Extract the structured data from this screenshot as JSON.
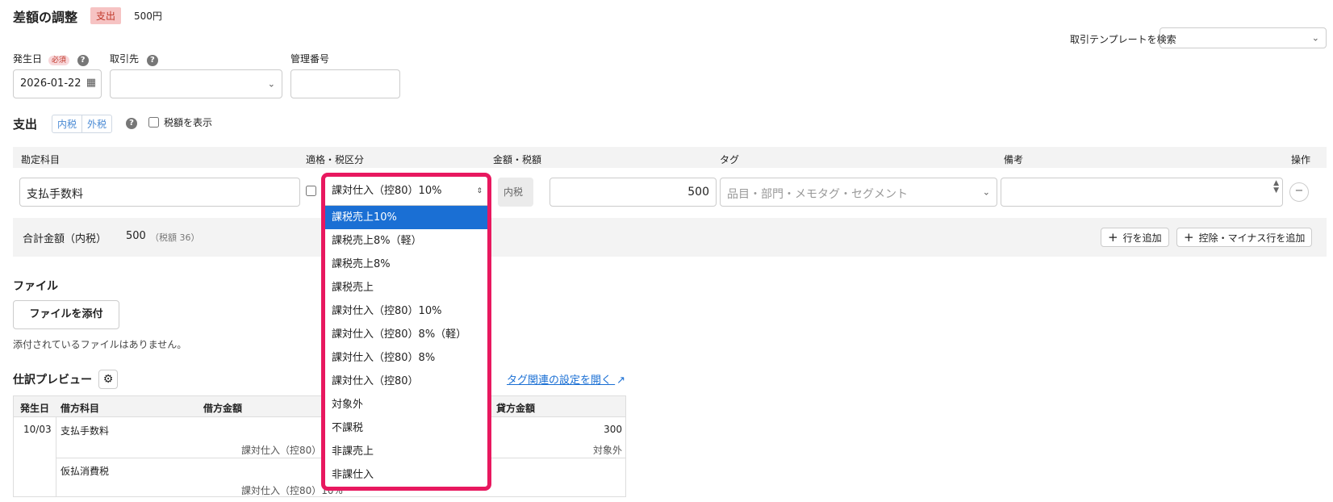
{
  "header": {
    "title": "差額の調整",
    "type_badge": "支出",
    "amount": "500円"
  },
  "template_search": {
    "label": "取引テンプレートを検索",
    "value": ""
  },
  "fields": {
    "date_label": "発生日",
    "required": "必須",
    "date_value": "2026-01-22",
    "partner_label": "取引先",
    "partner_value": "",
    "manage_no_label": "管理番号",
    "manage_no_value": ""
  },
  "expense": {
    "title": "支出",
    "tax_incl": "内税",
    "tax_excl": "外税",
    "show_tax_label": "税額を表示",
    "columns": {
      "account": "勘定科目",
      "tax_class": "適格・税区分",
      "amount_tax": "金額・税額",
      "tag": "タグ",
      "memo": "備考",
      "ops": "操作"
    },
    "row": {
      "account": "支払手数料",
      "tax_class": "課対仕入（控80）10%",
      "tax_mode": "内税",
      "amount": "500",
      "tag_placeholder": "品目・部門・メモタグ・セグメント",
      "memo": ""
    },
    "total_label": "合計金額（内税）",
    "total_value": "500",
    "total_tax": "（税額 36）",
    "add_row": "行を追加",
    "add_deduct_row": "控除・マイナス行を追加"
  },
  "file": {
    "title": "ファイル",
    "attach_button": "ファイルを添付",
    "empty_text": "添付されているファイルはありません。"
  },
  "preview": {
    "title": "仕訳プレビュー",
    "tag_link": "タグ関連の設定を開く",
    "columns": {
      "date": "発生日",
      "debit_account": "借方科目",
      "debit_amount": "借方金額",
      "credit_amount": "貸方金額"
    },
    "rows": [
      {
        "date": "10/03",
        "debit_account": "支払手数料",
        "debit_tax": "課対仕入（控80）10%",
        "credit_amount": "300",
        "credit_tax": "対象外"
      },
      {
        "date": "",
        "debit_account": "仮払消費税",
        "debit_tax": "課対仕入（控80）10%",
        "credit_amount": "",
        "credit_tax": ""
      }
    ]
  },
  "dropdown": {
    "selected": "課対仕入（控80）10%",
    "highlighted_index": 0,
    "options": [
      "課税売上10%",
      "課税売上8%（軽）",
      "課税売上8%",
      "課税売上",
      "課対仕入（控80）10%",
      "課対仕入（控80）8%（軽）",
      "課対仕入（控80）8%",
      "課対仕入（控80）",
      "対象外",
      "不課税",
      "非課売上",
      "非課仕入"
    ]
  },
  "colors": {
    "highlight_border": "#e8185f",
    "option_active": "#1a6fd4",
    "link": "#1a6fd4"
  }
}
